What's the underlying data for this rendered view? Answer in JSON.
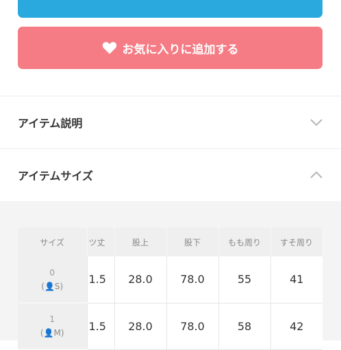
{
  "buttons": {
    "favorite_label": "お気に入りに追加する"
  },
  "sections": {
    "description_title": "アイテム説明",
    "size_title": "アイテムサイズ"
  },
  "size_table": {
    "headers": [
      "サイズ",
      "ツ丈",
      "股上",
      "股下",
      "もも周り",
      "すそ周り"
    ],
    "rows": [
      {
        "num": "0",
        "open": "(",
        "icon": "👤",
        "size": "S",
        "close": ")",
        "values": [
          "1.5",
          "28.0",
          "78.0",
          "55",
          "41"
        ]
      },
      {
        "num": "1",
        "open": "(",
        "icon": "👤",
        "size": "M",
        "close": ")",
        "values": [
          "1.5",
          "28.0",
          "78.0",
          "58",
          "42"
        ]
      }
    ]
  },
  "colors": {
    "primary_button": "#2aa9de",
    "favorite_button": "#f57b84",
    "size_icon": "#e05561"
  },
  "icons": {
    "favorite": "heart-icon",
    "description_toggle": "chevron-down-icon",
    "size_toggle": "chevron-up-icon"
  }
}
